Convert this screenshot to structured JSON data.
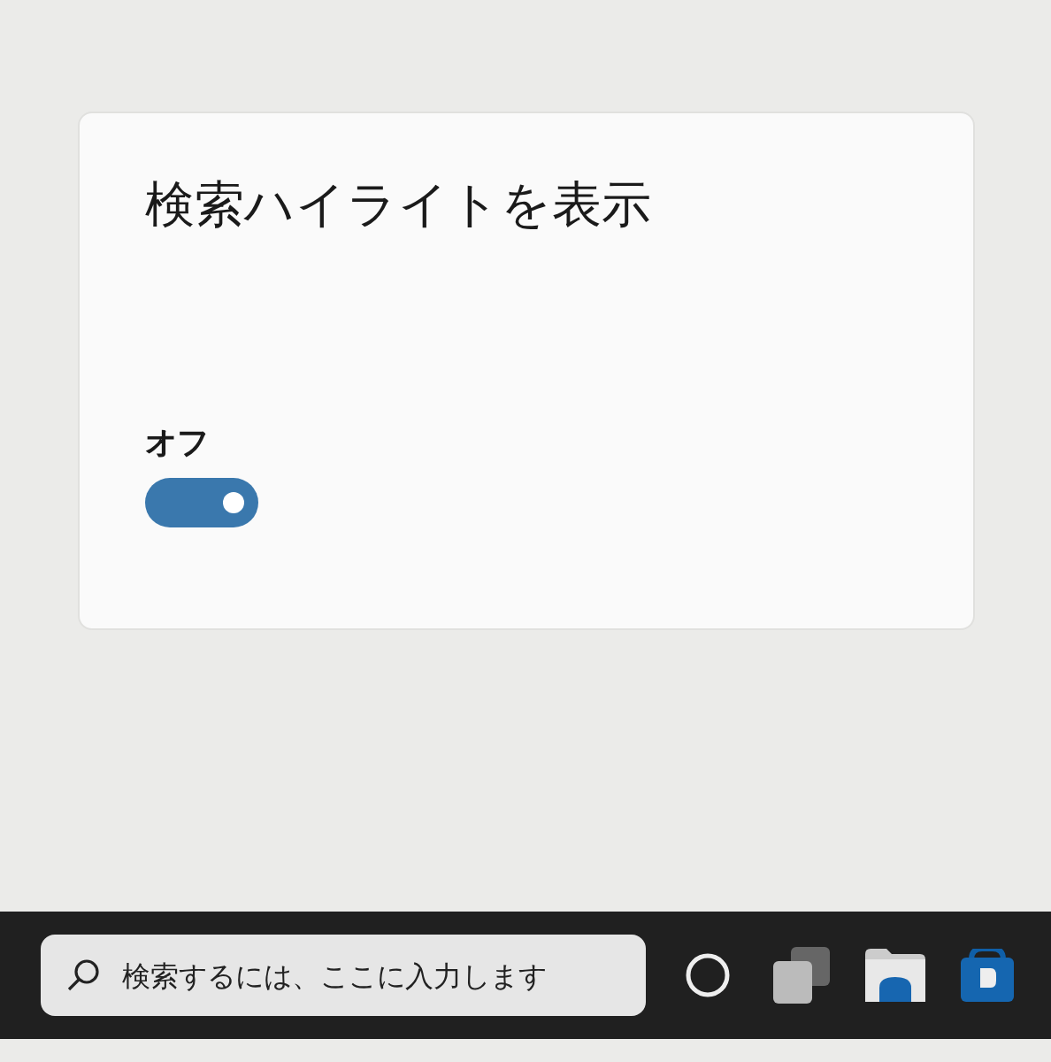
{
  "setting": {
    "title": "検索ハイライトを表示",
    "state_label": "オフ",
    "toggle": {
      "on": true
    }
  },
  "taskbar": {
    "search": {
      "placeholder": "検索するには、ここに入力します"
    }
  }
}
